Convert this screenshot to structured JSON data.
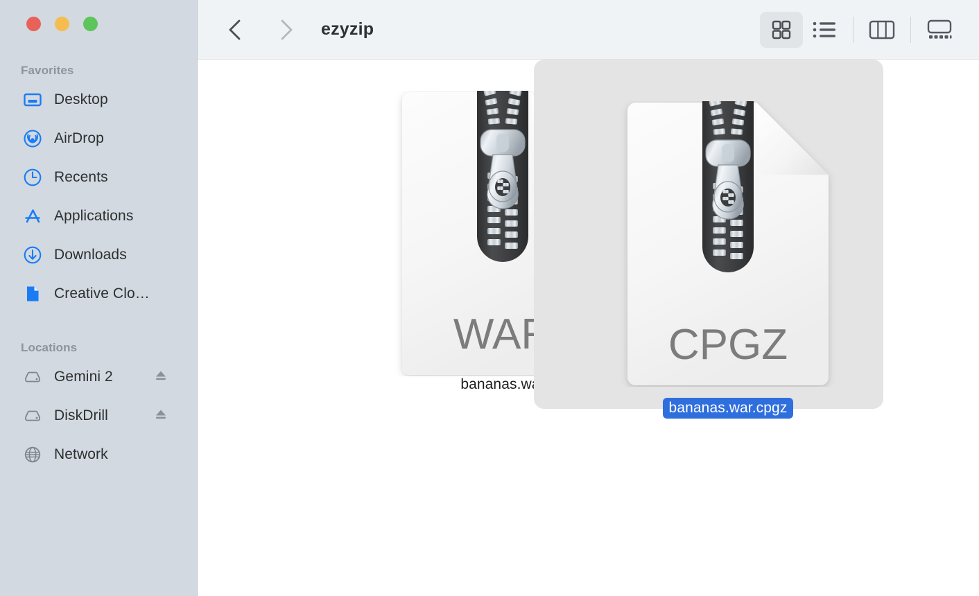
{
  "window": {
    "title": "ezyzip",
    "traffic_lights": [
      {
        "name": "close",
        "color": "#e8625a"
      },
      {
        "name": "minimize",
        "color": "#f5bd4f"
      },
      {
        "name": "maximize",
        "color": "#5ec45c"
      }
    ]
  },
  "toolbar": {
    "back_icon": "chevron-left-icon",
    "forward_icon": "chevron-right-icon",
    "back_enabled": true,
    "forward_enabled": false,
    "view_modes": [
      {
        "name": "icon-view",
        "icon": "grid-icon",
        "active": true
      },
      {
        "name": "list-view",
        "icon": "list-icon",
        "active": false
      },
      {
        "name": "column-view",
        "icon": "columns-icon",
        "active": false
      },
      {
        "name": "gallery-view",
        "icon": "gallery-icon",
        "active": false
      }
    ]
  },
  "sidebar": {
    "sections": [
      {
        "header": "Favorites",
        "items": [
          {
            "label": "Desktop",
            "icon": "desktop-icon",
            "eject": false
          },
          {
            "label": "AirDrop",
            "icon": "airdrop-icon",
            "eject": false
          },
          {
            "label": "Recents",
            "icon": "clock-icon",
            "eject": false
          },
          {
            "label": "Applications",
            "icon": "applications-icon",
            "eject": false
          },
          {
            "label": "Downloads",
            "icon": "download-icon",
            "eject": false
          },
          {
            "label": "Creative Clo…",
            "icon": "document-icon",
            "eject": false
          }
        ]
      },
      {
        "header": "Locations",
        "items": [
          {
            "label": "Gemini 2",
            "icon": "drive-icon",
            "eject": true
          },
          {
            "label": "DiskDrill",
            "icon": "drive-icon",
            "eject": true
          },
          {
            "label": "Network",
            "icon": "globe-icon",
            "eject": false
          }
        ]
      }
    ]
  },
  "files": [
    {
      "name": "bananas.war",
      "ext_label": "WAR",
      "icon": "zip-archive-icon",
      "selected": false
    },
    {
      "name": "bananas.war.cpgz",
      "ext_label": "CPGZ",
      "icon": "zip-archive-icon",
      "selected": true
    }
  ],
  "colors": {
    "sidebar_bg": "#d2d9e0",
    "toolbar_bg": "#eff3f6",
    "content_bg": "#ffffff",
    "accent_blue": "#2f6fdd",
    "selection_bg": "#e4e4e4",
    "sidebar_icon_blue": "#1a7cf5",
    "sidebar_icon_gray": "#7d858e"
  }
}
